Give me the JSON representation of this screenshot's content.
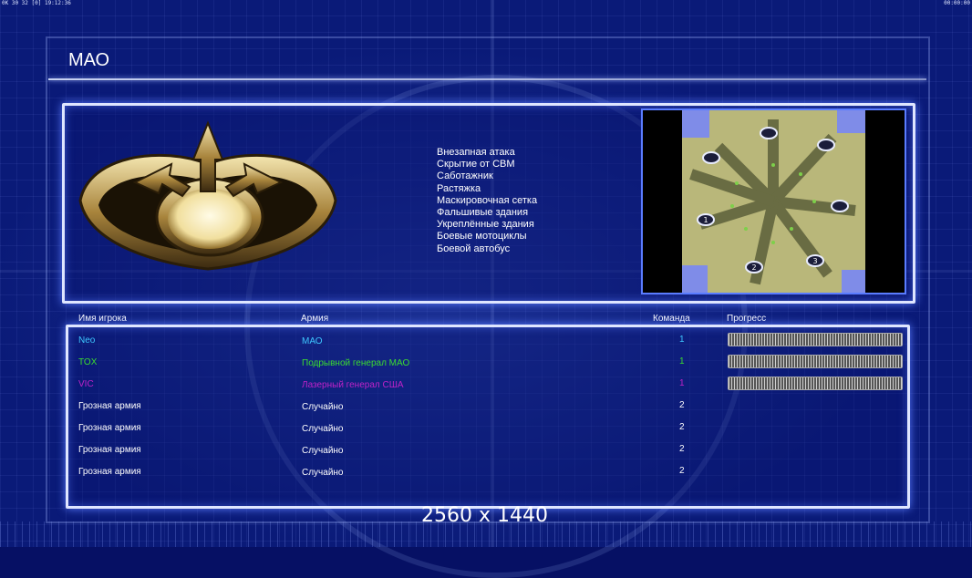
{
  "status_bar": {
    "left": "0K 30 32 [0] 19:12:36",
    "right": "00:00:00"
  },
  "title": "МАО",
  "powers": [
    "Внезапная атака",
    "Скрытие от СВМ",
    "Саботажник",
    "Растяжка",
    "Маскировочная сетка",
    "Фальшивые здания",
    "Укреплённые здания",
    "Боевые мотоциклы",
    "Боевой автобус"
  ],
  "map": {
    "start_labels": [
      "1",
      "2",
      "3"
    ]
  },
  "table": {
    "headers": {
      "player": "Имя игрока",
      "army": "Армия",
      "team": "Команда",
      "progress": "Прогресс"
    },
    "rows": [
      {
        "player": "Neo",
        "army": "МАО",
        "team": "1",
        "color": "#3ec7ff",
        "has_progress": true
      },
      {
        "player": "TOX",
        "army": "Подрывной генерал МАО",
        "team": "1",
        "color": "#3bdc2f",
        "has_progress": true
      },
      {
        "player": "VIC",
        "army": "Лазерный генерал США",
        "team": "1",
        "color": "#c022c8",
        "has_progress": true
      },
      {
        "player": "Грозная армия",
        "army": "Случайно",
        "team": "2",
        "color": "#ffffff",
        "has_progress": false
      },
      {
        "player": "Грозная армия",
        "army": "Случайно",
        "team": "2",
        "color": "#ffffff",
        "has_progress": false
      },
      {
        "player": "Грозная армия",
        "army": "Случайно",
        "team": "2",
        "color": "#ffffff",
        "has_progress": false
      },
      {
        "player": "Грозная армия",
        "army": "Случайно",
        "team": "2",
        "color": "#ffffff",
        "has_progress": false
      }
    ]
  },
  "resolution_label": "2560 x 1440",
  "colors": {
    "background": "#0a1a78",
    "panel_border": "#dfe6ff",
    "glow": "#5a7cff"
  }
}
